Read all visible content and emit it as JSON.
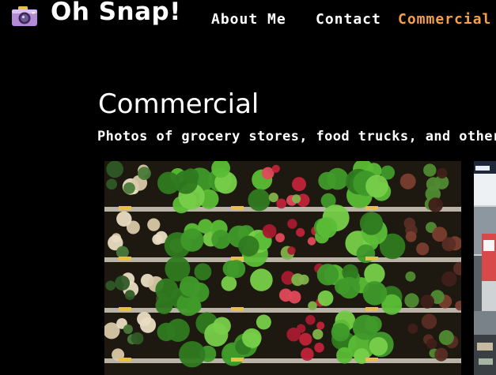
{
  "header": {
    "brand": "Oh Snap!",
    "logo_icon": "camera-icon",
    "nav": [
      {
        "label": "About Me",
        "active": false
      },
      {
        "label": "Contact",
        "active": false
      },
      {
        "label": "Commercial",
        "active": true
      }
    ]
  },
  "main": {
    "title": "Commercial",
    "subtitle": "Photos of grocery stores, food trucks, and other",
    "photos": [
      {
        "icon": "grocery-produce-shelves-photo"
      },
      {
        "icon": "store-interior-photo"
      }
    ]
  },
  "colors": {
    "background": "#000000",
    "text": "#ffffff",
    "active_nav": "#f5a04b"
  }
}
